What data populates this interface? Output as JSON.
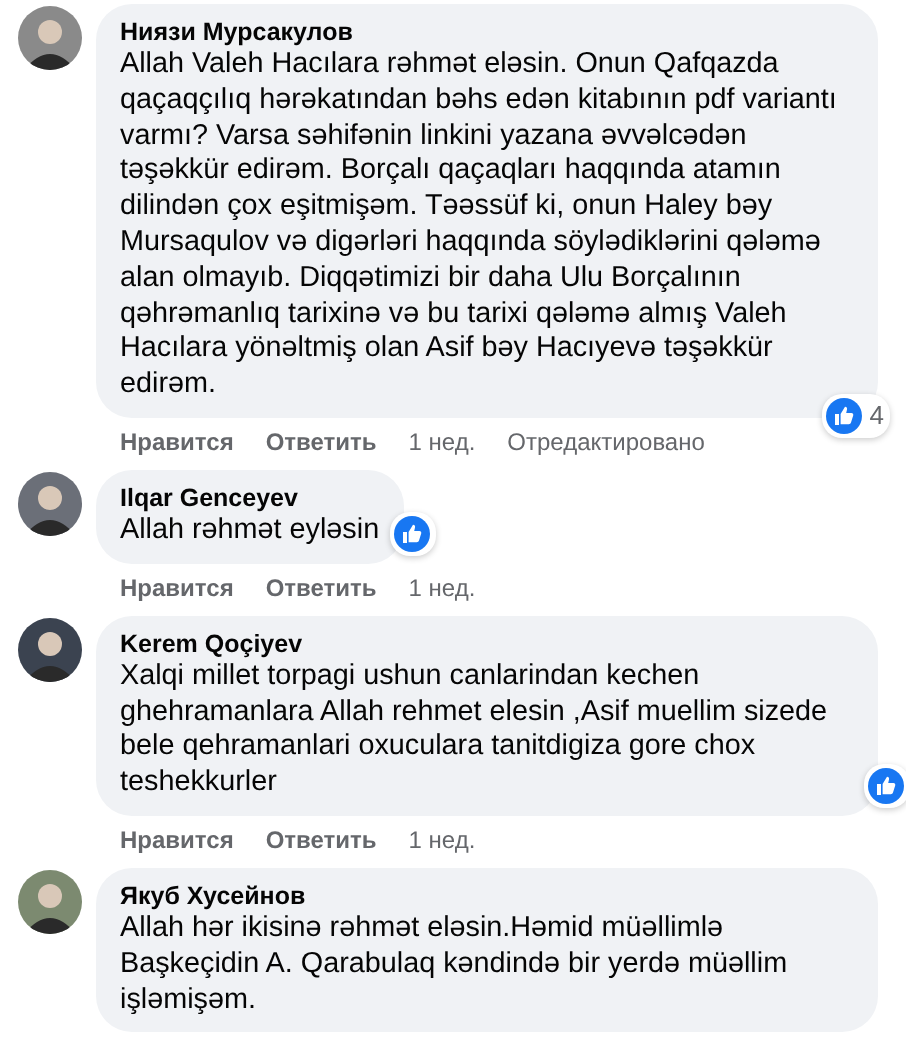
{
  "comments": [
    {
      "author": "Ниязи Мурсакулов",
      "text": "Allah Valeh Hacılara rəhmət eləsin. Onun Qafqazda qaçaqçılıq hərəkatından bəhs edən kitabının pdf variantı varmı? Varsa səhifənin linkini yazana əvvəlcədən təşəkkür edirəm. Borçalı qaçaqları haqqında atamın dilindən çox eşitmişəm. Təəssüf ki, onun Haley bəy Mursaqulov və digərləri haqqında söylədiklərini qələmə alan olmayıb. Diqqətimizi bir daha Ulu Borçalının qəhrəmanlıq tarixinə və bu tarixi qələmə almış Valeh Hacılara yönəltmiş olan Asif bəy Hacıyevə təşəkkür edirəm.",
      "like": "Нравится",
      "reply": "Ответить",
      "time": "1 нед.",
      "edited": "Отредактировано",
      "reaction_count": "4"
    },
    {
      "author": "Ilqar Genceyev",
      "text": "Allah rəhmət eyləsin",
      "like": "Нравится",
      "reply": "Ответить",
      "time": "1 нед."
    },
    {
      "author": "Kerem Qoçiyev",
      "text": "Xalqi millet torpagi ushun canlarindan kechen ghehramanlara Allah rehmet elesin ,Asif muellim sizede bele qehramanlari oxuculara tanitdigiza gore chox teshekkurler",
      "like": "Нравится",
      "reply": "Ответить",
      "time": "1 нед."
    },
    {
      "author": "Якуб Хусейнов",
      "text": "Allah hər ikisinə rəhmət eləsin.Həmid müəllimlə Başkeçidin A. Qarabulaq kəndində bir yerdə müəllim işləmişəm."
    }
  ]
}
